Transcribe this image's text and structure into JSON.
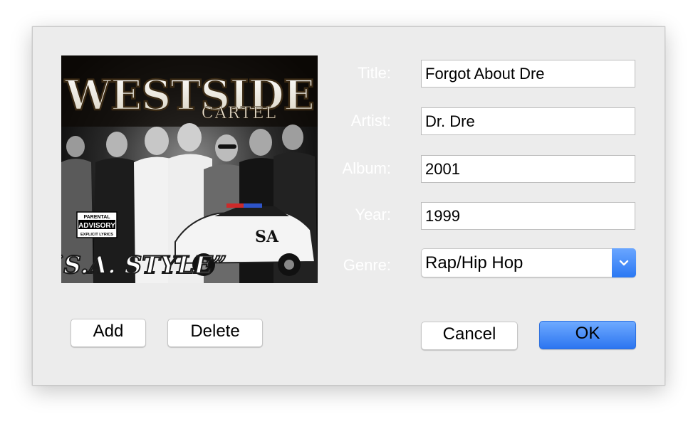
{
  "artwork": {
    "title_text": "WESTSIDE",
    "subtitle_text": "CARTEL",
    "bottom_text": "“S.A. STYLE”",
    "advisory_line1": "PARENTAL",
    "advisory_line2": "ADVISORY",
    "advisory_line3": "EXPLICIT LYRICS"
  },
  "fields": {
    "title": {
      "label": "Title:",
      "value": "Forgot About Dre"
    },
    "artist": {
      "label": "Artist:",
      "value": "Dr. Dre"
    },
    "album": {
      "label": "Album:",
      "value": "2001"
    },
    "year": {
      "label": "Year:",
      "value": "1999"
    },
    "genre": {
      "label": "Genre:",
      "value": "Rap/Hip Hop"
    }
  },
  "buttons": {
    "add": "Add",
    "delete": "Delete",
    "cancel": "Cancel",
    "ok": "OK"
  },
  "colors": {
    "accent": "#2c75f0",
    "dialog_bg": "#ececec"
  }
}
